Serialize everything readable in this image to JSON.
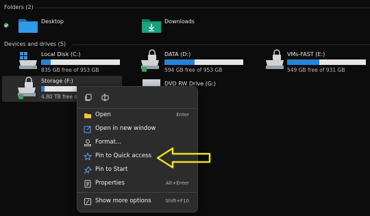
{
  "folders_header": "Folders (2)",
  "folders": [
    {
      "label": "Desktop",
      "icon": "desktop-folder-icon"
    },
    {
      "label": "Downloads",
      "icon": "downloads-folder-icon"
    }
  ],
  "drives_header": "Devices and drives (5)",
  "drives": [
    {
      "label": "Local Disk (C:)",
      "free": "835 GB free of 953 GB",
      "used_fraction": 0.12
    },
    {
      "label": "DATA (D:)",
      "free": "594 GB free of 953 GB",
      "used_fraction": 0.38
    },
    {
      "label": "VMs-FAST (E:)",
      "free": "549 GB free of 931 GB",
      "used_fraction": 0.41
    },
    {
      "label": "Storage (F:)",
      "free": "4.80 TB free of 1",
      "used_fraction": 0.1
    },
    {
      "label": "DVD RW Drive (G:)"
    }
  ],
  "context_menu": {
    "items": [
      {
        "label": "Open",
        "shortcut": "Enter",
        "icon": "open-icon"
      },
      {
        "label": "Open in new window",
        "shortcut": "",
        "icon": "new-window-icon"
      },
      {
        "label": "Format...",
        "shortcut": "",
        "icon": "format-icon"
      },
      {
        "label": "Pin to Quick access",
        "shortcut": "",
        "icon": "pin-star-icon"
      },
      {
        "label": "Pin to Start",
        "shortcut": "",
        "icon": "pin-icon"
      },
      {
        "label": "Properties",
        "shortcut": "Alt+Enter",
        "icon": "properties-icon"
      },
      {
        "label": "Show more options",
        "shortcut": "Shift+F10",
        "icon": "more-options-icon"
      }
    ]
  },
  "colors": {
    "accent": "#2584d6",
    "arrow": "#f0e31b"
  }
}
